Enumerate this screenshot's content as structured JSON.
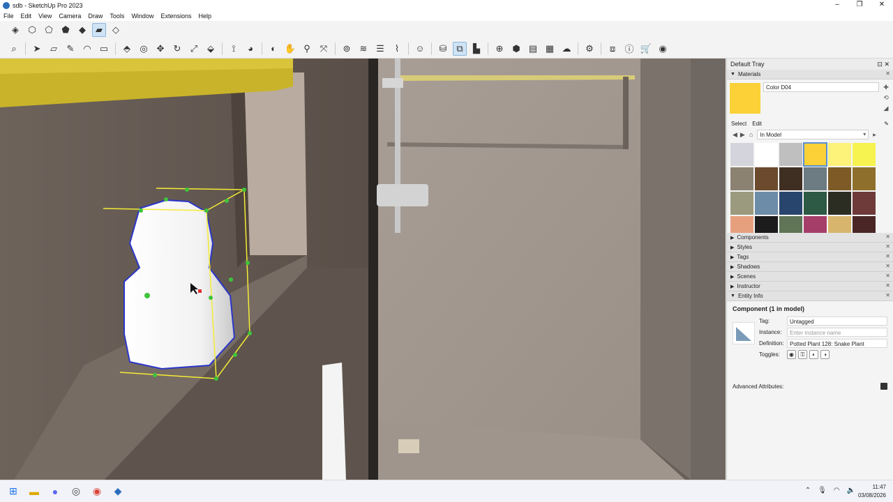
{
  "window": {
    "title": "sdb - SketchUp Pro 2023",
    "controls": [
      "–",
      "❐",
      "✕"
    ]
  },
  "menu": [
    "File",
    "Edit",
    "View",
    "Camera",
    "Draw",
    "Tools",
    "Window",
    "Extensions",
    "Help"
  ],
  "tray": {
    "title": "Default Tray",
    "materials": {
      "header": "Materials",
      "current_name": "Color D04",
      "current_color": "#fcd137",
      "tabs": [
        "Select",
        "Edit"
      ],
      "library": "In Model",
      "swatches": [
        "#d4d4dc",
        "#ffffff",
        "#bfbfbf",
        "#fcd137",
        "#fdf27a",
        "#f6f250",
        "#8b8272",
        "#6b4a2d",
        "#3f2e22",
        "#6d7b82",
        "#7d5a26",
        "#8f6f2c",
        "#9b9a7e",
        "#6c8ca8",
        "#28456e",
        "#2c5a44",
        "#2b2d22",
        "#6e3a3a",
        "#e6a07e",
        "#1c1c1c",
        "#5f7555",
        "#a63e6a",
        "#d7b56d",
        "#4a2626"
      ]
    },
    "panels": [
      "Components",
      "Styles",
      "Tags",
      "Shadows",
      "Scenes",
      "Instructor"
    ],
    "entity_info": {
      "header": "Entity Info",
      "title": "Component (1 in model)",
      "tag_label": "Tag:",
      "tag_value": "Untagged",
      "instance_label": "Instance:",
      "instance_placeholder": "Enter instance name",
      "definition_label": "Definition:",
      "definition_value": "Potted Plant 128: Snake Plant",
      "toggles_label": "Toggles:",
      "advanced": "Advanced Attributes:"
    }
  },
  "taskbar": {
    "time": "11:47",
    "date": "03/08/2026"
  },
  "colors": {
    "selection": "#f4ec34",
    "selected_edges": "#2b36c8",
    "grip": "#3ec43a"
  }
}
